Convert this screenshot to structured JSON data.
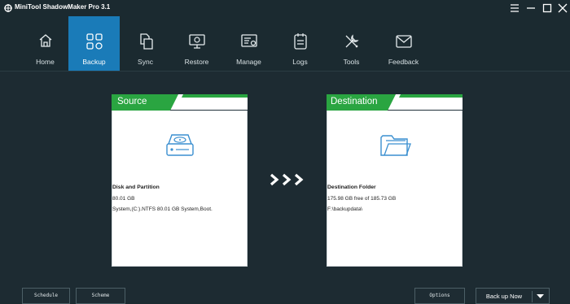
{
  "app": {
    "title": "MiniTool ShadowMaker Pro 3.1"
  },
  "nav": [
    {
      "label": "Home",
      "icon": "home-icon"
    },
    {
      "label": "Backup",
      "icon": "backup-icon",
      "active": true
    },
    {
      "label": "Sync",
      "icon": "sync-icon"
    },
    {
      "label": "Restore",
      "icon": "restore-icon"
    },
    {
      "label": "Manage",
      "icon": "manage-icon"
    },
    {
      "label": "Logs",
      "icon": "logs-icon"
    },
    {
      "label": "Tools",
      "icon": "tools-icon"
    },
    {
      "label": "Feedback",
      "icon": "feedback-icon"
    }
  ],
  "source": {
    "tab": "Source",
    "title": "Disk and Partition",
    "size": "80.01 GB",
    "detail": "System,(C:).NTFS 80.01 GB System,Boot."
  },
  "destination": {
    "tab": "Destination",
    "title": "Destination Folder",
    "free": "175.98 GB free of 185.73 GB",
    "path": "F:\\backupdata\\"
  },
  "buttons": {
    "schedule": "Schedule",
    "scheme": "Scheme",
    "options": "Options",
    "backup_now": "Back up Now"
  },
  "colors": {
    "accent_blue": "#1a7bb8",
    "tab_green": "#2aa541",
    "background": "#1d2b32"
  }
}
